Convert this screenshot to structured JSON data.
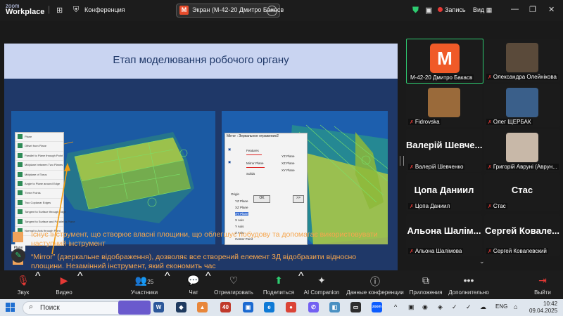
{
  "app": {
    "logo_line1": "zoom",
    "logo_line2": "Workplace",
    "conference_label": "Конференция"
  },
  "share": {
    "title": "Экран (М-42-20 Дмитро Бакасв",
    "badge_letter": "М"
  },
  "top_right": {
    "record_label": "Запись",
    "view_label": "Вид"
  },
  "slide": {
    "title": "Етап моделювання робочого органу",
    "menu_items": [
      "Plane",
      "Offset from Plane",
      "Parallel to Plane through Point",
      "Midplane between Two Planes",
      "Midplane of Torus",
      "Angle to Plane around Edge",
      "Three Points",
      "Two Coplanar Edges",
      "Tangent to Surface through Edge",
      "Tangent to Surface and Parallel to Plane",
      "Normal to Axis through Point"
    ],
    "dialog": {
      "title": "Mirror : Зеркальное отражение2",
      "features": "Features",
      "mirror_plane": "Mirror Plane",
      "solids": "Solids",
      "planes": [
        "YZ Plane",
        "XZ Plane",
        "XY Plane"
      ],
      "tree": [
        "Origin",
        "YZ Plane",
        "XZ Plane",
        "XY Plane",
        "X Axis",
        "Y Axis",
        "Z Axis",
        "Center Point"
      ],
      "ok": "OK",
      "more": ">>"
    },
    "plane_label": "Plane",
    "bullet1": "Існує інструмент, що створює власні площини, що облегшує побудову та допомагає використовувати наступний інструмент",
    "bullet2": "“Mirror” (дзеркальне відображення), дозволяє все створений елемент 3Д відобразити відносно площини. Незамінний інструмент, який економить час"
  },
  "participants_panel": [
    {
      "name": "М-42-20 Дмитро Бакасв",
      "type": "letter",
      "letter": "М",
      "active": true
    },
    {
      "name": "Олександра Олейнікова",
      "type": "photo",
      "color": "#5a4a3a"
    },
    {
      "name": "Fidrovska",
      "type": "photo",
      "color": "#9a6a3a"
    },
    {
      "name": "Олег ЩЕРБАК",
      "type": "photo",
      "color": "#3a5f8a"
    },
    {
      "name": "Валерій Шевченко",
      "big": "Валерій Шевче...",
      "type": "text"
    },
    {
      "name": "Григорій Авруні (Аврун...",
      "type": "photo",
      "color": "#c8b8a8"
    },
    {
      "name": "Цопа Даниил",
      "big": "Цопа Даниил",
      "type": "text"
    },
    {
      "name": "Стас",
      "big": "Стас",
      "type": "text"
    },
    {
      "name": "Альона Шалімова",
      "big": "Альона Шалім...",
      "type": "text"
    },
    {
      "name": "Сергей Ковалевский",
      "big": "Сергей Ковале...",
      "type": "text"
    }
  ],
  "toolbar": {
    "audio": "Звук",
    "video": "Видео",
    "participants": "Участники",
    "participants_count": "25",
    "chat": "Чат",
    "reactions": "Отреагировать",
    "share": "Поделиться",
    "ai": "AI Companion",
    "conf_data": "Данные конференции",
    "apps": "Приложения",
    "more": "Дополнительно",
    "leave": "Выйти"
  },
  "taskbar": {
    "search": "Поиск",
    "lang": "ENG",
    "time": "10:42",
    "date": "09.04.2025",
    "badge_40": "40"
  }
}
